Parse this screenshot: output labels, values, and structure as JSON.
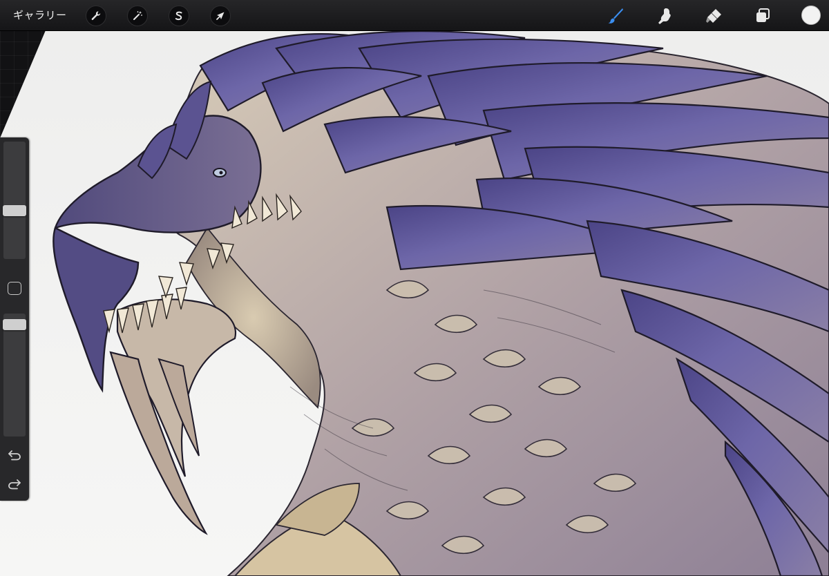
{
  "toolbar": {
    "gallery_label": "ギャラリー",
    "left_tools": [
      {
        "name": "actions",
        "icon": "wrench-icon"
      },
      {
        "name": "adjustments",
        "icon": "magic-wand-icon"
      },
      {
        "name": "selection",
        "icon": "selection-s-icon"
      },
      {
        "name": "transform",
        "icon": "arrow-cursor-icon"
      }
    ],
    "right_tools": [
      {
        "name": "brush",
        "icon": "brush-icon",
        "active": true
      },
      {
        "name": "smudge",
        "icon": "smudge-finger-icon",
        "active": false
      },
      {
        "name": "eraser",
        "icon": "eraser-icon",
        "active": false
      },
      {
        "name": "layers",
        "icon": "layers-icon",
        "active": false
      }
    ],
    "current_color": "#f2f2f2",
    "active_tool_color": "#3b8ef0"
  },
  "sidebar": {
    "brush_size_level": 0.4,
    "opacity_level": 0.95,
    "modify_button_icon": "square-outline-icon",
    "undo_icon": "undo-arrow-icon",
    "redo_icon": "redo-arrow-icon"
  },
  "canvas": {
    "artwork_description_icon": "dragon-artwork",
    "paper_color": "#f3f2f1",
    "scale_color_primary": "#5c5596",
    "scale_color_light": "#cfc1ad"
  }
}
